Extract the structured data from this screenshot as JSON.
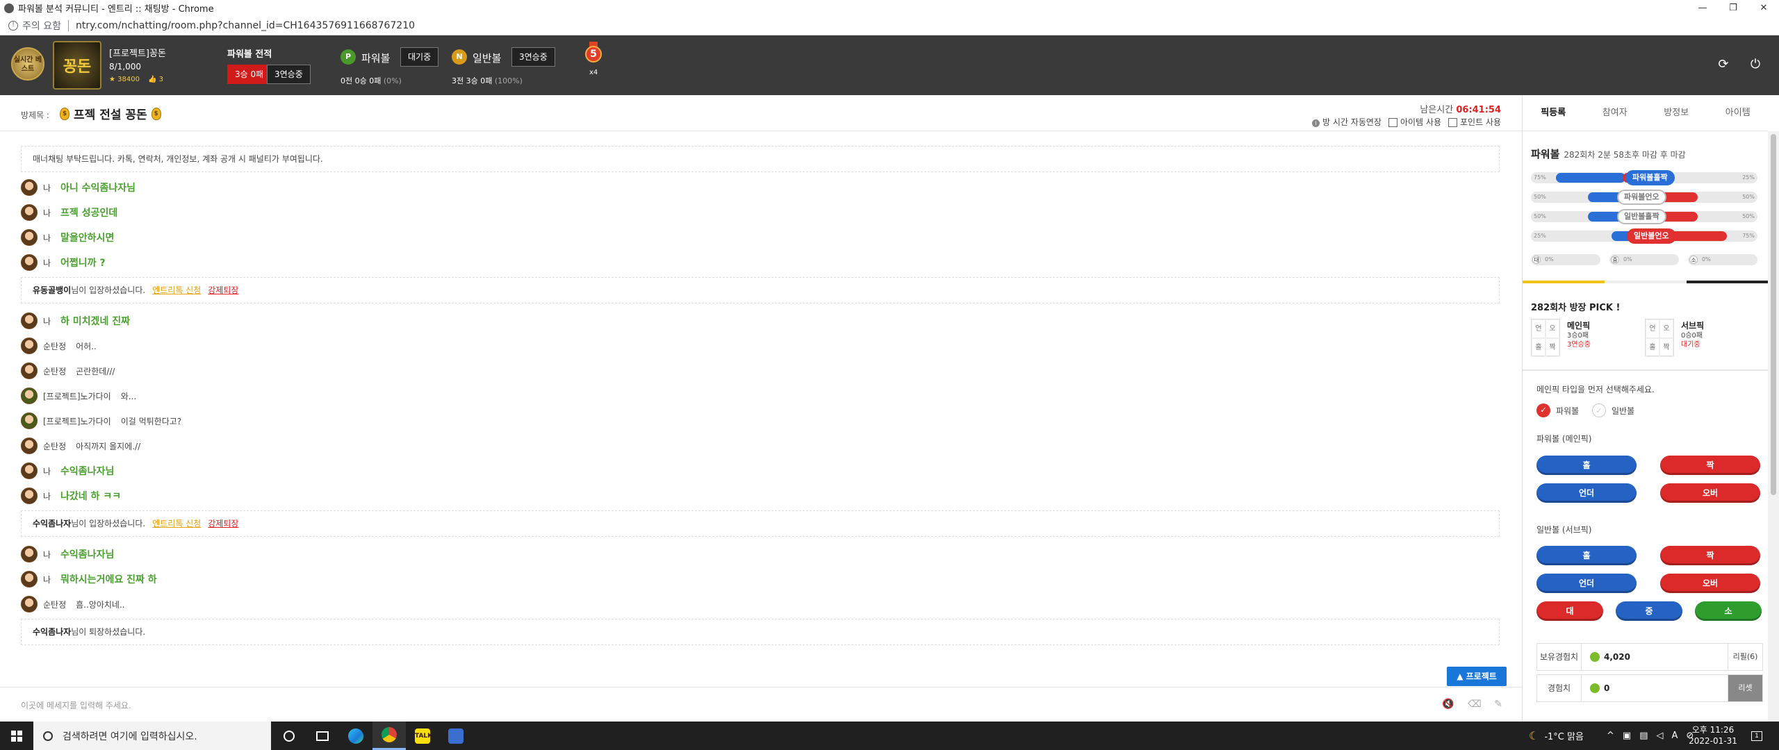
{
  "window": {
    "title": "파워볼 분석 커뮤니티 - 엔트리 :: 채팅방 - Chrome",
    "warning": "주의 요함",
    "url": "ntry.com/nchatting/room.php?channel_id=CH1643576911668767210",
    "controls": [
      "—",
      "❐",
      "✕"
    ]
  },
  "header": {
    "badge_text": "실시간 베스트",
    "avatar_text": "꽁돈",
    "nickname": "[프로젝트]꽁돈",
    "level": "8/1,000",
    "points": "38400",
    "likes": "3",
    "powerball_record_title": "파워볼 전적",
    "record_loss": "3승 0패",
    "record_streak": "3연승중",
    "powerball_label": "파워볼",
    "powerball_icon": "P",
    "powerball_status": "대기중",
    "powerball_record": "0전 0승 0패",
    "powerball_pct": "(0%)",
    "normalball_label": "일반볼",
    "normalball_icon": "N",
    "normalball_status": "3연승중",
    "normalball_record": "3전 3승 0패",
    "normalball_pct": "(100%)",
    "medal_number": "5",
    "medal_multiplier": "x4",
    "refresh_icon": "⟳",
    "power_icon": "⏻"
  },
  "room": {
    "label": "방제목 :",
    "title": "프젝 전설 꽁돈",
    "bag_glyph": "$",
    "remain_label": "남은시간",
    "remain_time": "06:41:54",
    "auto_extend": "방 시간 자동연장",
    "info_glyph": "i",
    "item_use": "아이템 사용",
    "point_use": "포인트 사용"
  },
  "chat": {
    "notice": "매너채팅 부탁드립니다. 카톡, 연락처, 개인정보, 계좌 공개 시 패널티가 부여됩니다.",
    "messages": [
      {
        "nick": "나",
        "text": "아니 수익좀나자님",
        "mine": true
      },
      {
        "nick": "나",
        "text": "프젝 성공인데",
        "mine": true
      },
      {
        "nick": "나",
        "text": "말을안하시면",
        "mine": true
      },
      {
        "nick": "나",
        "text": "어쩝니까 ?",
        "mine": true
      },
      {
        "nick": "나",
        "text": "하 미치겠네 진짜",
        "mine": true
      },
      {
        "nick": "순탄정",
        "text": "어허..",
        "mine": false
      },
      {
        "nick": "순탄정",
        "text": "곤란한데///",
        "mine": false
      },
      {
        "nick": "[프로젝트]노가다이",
        "text": "와...",
        "mine": false
      },
      {
        "nick": "[프로젝트]노가다이",
        "text": "이걸 먹튀한다고?",
        "mine": false
      },
      {
        "nick": "순탄정",
        "text": "아직까지 올지에.//",
        "mine": false
      },
      {
        "nick": "나",
        "text": "수익좀나자님",
        "mine": true
      },
      {
        "nick": "나",
        "text": "나갔네 하 ㅋㅋ",
        "mine": true
      },
      {
        "nick": "나",
        "text": "수익좀나자님",
        "mine": true
      },
      {
        "nick": "나",
        "text": "뭐하시는거에요 진짜 하",
        "mine": true
      },
      {
        "nick": "순탄정",
        "text": "흠..앙아치네..",
        "mine": false
      }
    ],
    "system": [
      {
        "user": "유동골뱅이",
        "text": "님이 입장하셨습니다.",
        "link1": "엔트리톡 신청",
        "link2": "강제퇴장"
      },
      {
        "user": "수익좀나자",
        "text": "님이 입장하셨습니다.",
        "link1": "엔트리톡 신청",
        "link2": "강제퇴장"
      },
      {
        "user": "수익좀나자",
        "text": "님이 퇴장하셨습니다."
      }
    ],
    "project_button": "▲ 프로젝트",
    "input_placeholder": "이곳에 메세지를 입력해 주세요.",
    "tools": [
      "🔇",
      "⌫",
      "✎"
    ]
  },
  "sidebar": {
    "tabs": [
      "픽등록",
      "참여자",
      "방정보",
      "아이템"
    ],
    "pb_title": "파워볼",
    "pb_round": "282회차 2분 58초후 마감 후 마감",
    "bars": [
      {
        "left": "75%",
        "right": "25%",
        "label": "파워볼홀짝",
        "style": "bl"
      },
      {
        "left": "50%",
        "right": "50%",
        "label": "파워볼언오",
        "style": "dim"
      },
      {
        "left": "50%",
        "right": "50%",
        "label": "일반볼홀짝",
        "style": "dim"
      },
      {
        "left": "25%",
        "right": "75%",
        "label": "일반볼언오",
        "style": "rd"
      }
    ],
    "small_bars": [
      {
        "icon": "대",
        "pct": "0%"
      },
      {
        "icon": "중",
        "pct": "0%"
      },
      {
        "icon": "소",
        "pct": "0%"
      }
    ],
    "pick_title": "282회차 방장 PICK !",
    "pick_grid": [
      "언",
      "오",
      "홀",
      "짝"
    ],
    "main_pick": {
      "title": "메인픽",
      "record": "3승0패",
      "streak": "3연승중"
    },
    "sub_pick": {
      "title": "서브픽",
      "record": "0승0패",
      "streak": "대기중"
    },
    "select_msg": "메인픽 타입을 먼저 선택해주세요.",
    "radio_powerball": "파워볼",
    "radio_normal": "일반볼",
    "check_glyph": "✓",
    "pb_section": "파워볼 (메인픽)",
    "normal_section": "일반볼 (서브픽)",
    "pb_buttons": [
      "홀",
      "짝",
      "언더",
      "오버"
    ],
    "normal_buttons": [
      "홀",
      "짝",
      "언더",
      "오버"
    ],
    "size_buttons": [
      "대",
      "중",
      "소"
    ],
    "exp_label": "보유경험치",
    "exp_value": "4,020",
    "exp_btn": "리필(6)",
    "xp_label": "경험치",
    "xp_value": "0",
    "xp_btn": "리셋"
  },
  "taskbar": {
    "search_placeholder": "검색하려면 여기에 입력하십시오.",
    "weather": "-1°C 맑음",
    "time": "오후 11:26",
    "date": "2022-01-31",
    "lang": "A",
    "notification": "1"
  },
  "colors": {
    "accent_red": "#d11a1a",
    "chat_green": "#4aa02e",
    "blue": "#2a6ed8"
  }
}
